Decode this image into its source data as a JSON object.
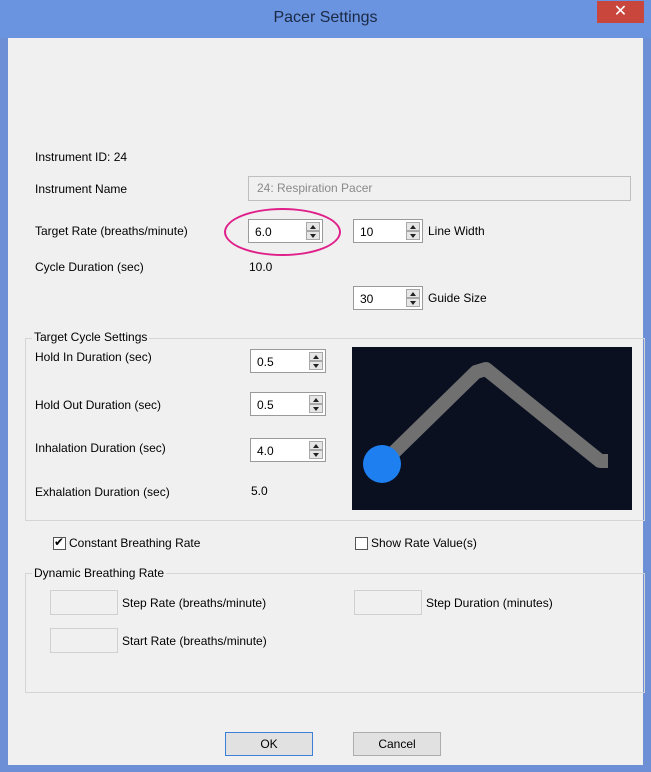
{
  "window": {
    "title": "Pacer Settings",
    "close_glyph": "✕"
  },
  "instrument": {
    "id_label": "Instrument ID: 24",
    "name_label": "Instrument Name",
    "name_value": "24: Respiration Pacer"
  },
  "target": {
    "rate_label": "Target Rate (breaths/minute)",
    "rate_value": "6.0",
    "cycle_label": "Cycle Duration (sec)",
    "cycle_value": "10.0"
  },
  "display": {
    "line_width_value": "10",
    "line_width_label": "Line Width",
    "guide_size_value": "30",
    "guide_size_label": "Guide Size"
  },
  "cycle_settings": {
    "group_title": "Target Cycle Settings",
    "hold_in_label": "Hold In Duration (sec)",
    "hold_in_value": "0.5",
    "hold_out_label": "Hold Out Duration (sec)",
    "hold_out_value": "0.5",
    "inhalation_label": "Inhalation Duration (sec)",
    "inhalation_value": "4.0",
    "exhalation_label": "Exhalation Duration (sec)",
    "exhalation_value": "5.0"
  },
  "preview": {
    "background": "#0a1020",
    "path_color": "#707070",
    "ball_color": "#1e7ff0"
  },
  "options": {
    "constant_label": "Constant Breathing Rate",
    "constant_checked": true,
    "show_rate_label": "Show Rate Value(s)",
    "show_rate_checked": false
  },
  "dynamic": {
    "group_title": "Dynamic Breathing Rate",
    "step_rate_label": "Step Rate (breaths/minute)",
    "start_rate_label": "Start Rate (breaths/minute)",
    "step_duration_label": "Step Duration (minutes)"
  },
  "buttons": {
    "ok": "OK",
    "cancel": "Cancel"
  },
  "annotation": {
    "highlight_color": "#e0208a"
  }
}
